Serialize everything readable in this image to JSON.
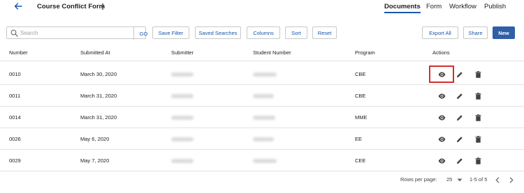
{
  "header": {
    "title": "Course Conflict Form",
    "back_icon": "arrow-left-icon",
    "menu_icon": "more-vertical-icon",
    "tabs": [
      "Documents",
      "Form",
      "Workflow",
      "Publish"
    ],
    "active_tab": "Documents"
  },
  "toolbar": {
    "search_placeholder": "Search",
    "search_value": "",
    "go_label": "GO",
    "save_filter_label": "Save Filter",
    "saved_searches_label": "Saved Searches",
    "columns_label": "Columns",
    "sort_label": "Sort",
    "reset_label": "Reset",
    "export_all_label": "Export All",
    "share_label": "Share",
    "new_label": "New"
  },
  "table": {
    "headers": [
      "Number",
      "Submitted At",
      "Submitter",
      "Student Number",
      "Program",
      "Actions"
    ],
    "rows": [
      {
        "number": "0010",
        "submitted_at": "March 30, 2020",
        "program": "CBE"
      },
      {
        "number": "0011",
        "submitted_at": "March 31, 2020",
        "program": "CBE"
      },
      {
        "number": "0014",
        "submitted_at": "March 31, 2020",
        "program": "MME"
      },
      {
        "number": "0026",
        "submitted_at": "May 6, 2020",
        "program": "EE"
      },
      {
        "number": "0029",
        "submitted_at": "May 7, 2020",
        "program": "CEE"
      }
    ],
    "action_icons": [
      "eye-icon",
      "pencil-icon",
      "trash-icon"
    ]
  },
  "pagination": {
    "rows_per_page_label": "Rows per page:",
    "rows_per_page_value": "25",
    "range": "1-5 of 5"
  },
  "colors": {
    "accent": "#1a56a8",
    "primary_button": "#2f5fa7",
    "highlight": "#d32f2f"
  }
}
